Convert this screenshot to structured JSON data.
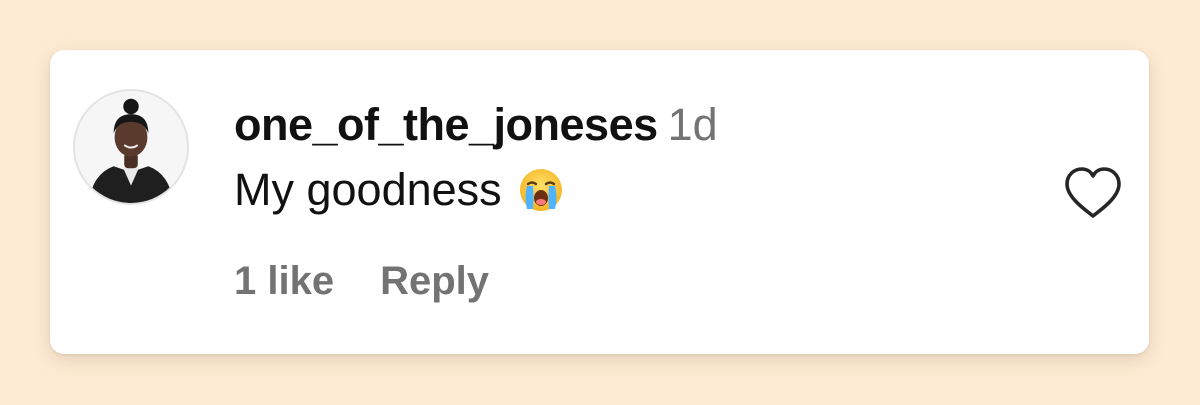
{
  "comment": {
    "username": "one_of_the_joneses",
    "timestamp": "1d",
    "text": "My goodness",
    "emoji": "loudly-crying-face-emoji",
    "likes_label": "1 like",
    "reply_label": "Reply",
    "like_icon": "heart-outline-icon"
  },
  "colors": {
    "background": "#fdebd3",
    "card": "#ffffff",
    "username": "#111111",
    "secondary_text": "#737373",
    "heart_stroke": "#262626"
  }
}
